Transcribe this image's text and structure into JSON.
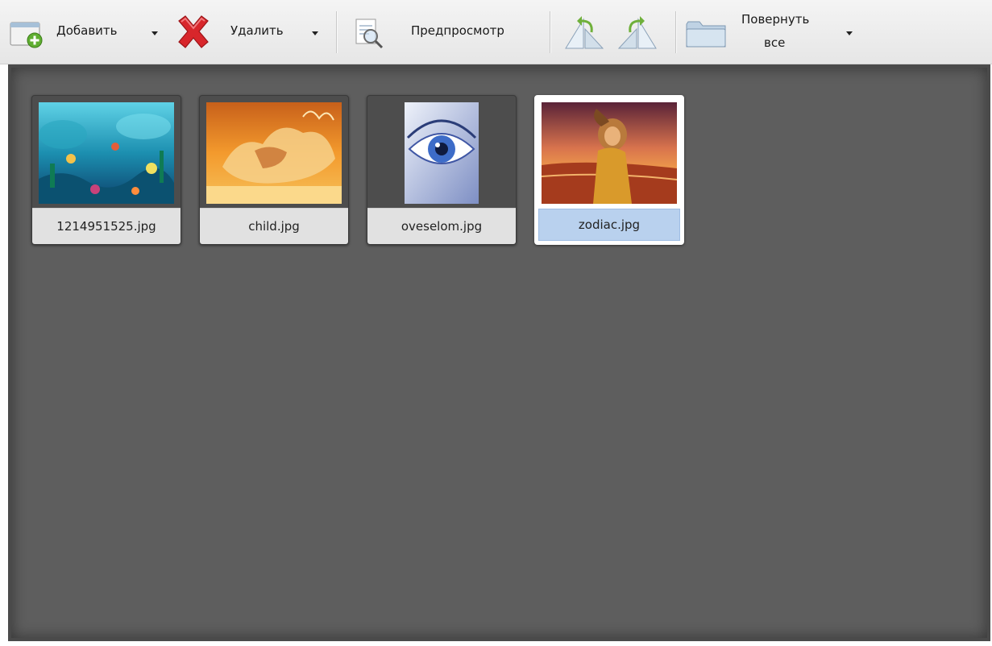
{
  "toolbar": {
    "add": {
      "label": "Добавить",
      "icon": "add-image-icon"
    },
    "delete": {
      "label": "Удалить",
      "icon": "red-x-icon",
      "color": "#d8262b"
    },
    "preview": {
      "label": "Предпросмотр",
      "icon": "preview-magnifier-icon"
    },
    "rotate_left": {
      "icon": "rotate-left-icon"
    },
    "rotate_right": {
      "icon": "rotate-right-icon"
    },
    "rotate_all": {
      "label_line1": "Повернуть",
      "label_line2": "все",
      "icon": "folder-icon"
    }
  },
  "gallery": {
    "background": "#5e5e5e",
    "items": [
      {
        "filename": "1214951525.jpg",
        "image": "underwater-scene",
        "selected": false
      },
      {
        "filename": "child.jpg",
        "image": "orange-sand-sculpture",
        "selected": false
      },
      {
        "filename": "oveselom.jpg",
        "image": "blue-eye",
        "selected": false
      },
      {
        "filename": "zodiac.jpg",
        "image": "zodiac-woman-sunset",
        "selected": true
      }
    ]
  },
  "colors": {
    "selection": "#b9d1ee",
    "accent_green": "#6fb03a"
  }
}
